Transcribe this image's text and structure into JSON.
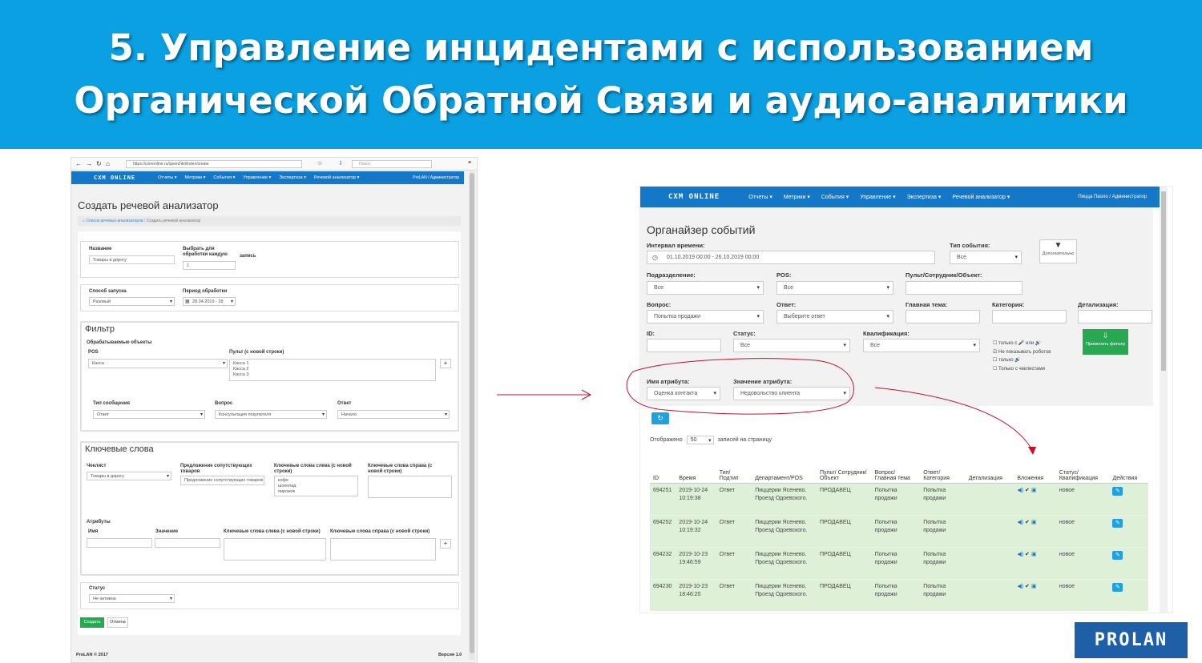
{
  "title": {
    "line1": "5. Управление инцидентами с использованием",
    "line2": "Органической Обратной Связи и аудио-аналитики"
  },
  "browser": {
    "url": "https://cxmonline.ru/speechkit/index/create",
    "search": "Поиск"
  },
  "app": {
    "logo": "CXM ONLINE",
    "nav": [
      "Отчеты ▾",
      "Метрики ▾",
      "События ▾",
      "Управление ▾",
      "Экспертиза ▾",
      "Речевой анализатор ▾"
    ],
    "user_left": "ProLAN / Администратор",
    "user_right": "Пицца Паоло / Администратор"
  },
  "left": {
    "page_title": "Создать речевой анализатор",
    "breadcrumb": [
      "Список речевых анализаторов",
      "Создать речевой анализатор"
    ],
    "name_label": "Название",
    "name_value": "Товары в дорогу",
    "every_label": "Выбрать для обработки каждую",
    "every_value": "1",
    "every_suffix": "запись",
    "launch_label": "Способ запуска",
    "launch_value": "Разовый",
    "period_label": "Период обработки",
    "period_value": "28.04.2019 - 28",
    "filter_title": "Фильтр",
    "objects_label": "Обрабатываемые объекты",
    "pos_label": "POS",
    "pos_value": "Касса",
    "consoles_label": "Пульт (с новой строки)",
    "consoles": [
      "Касса 1",
      "Касса 2",
      "Касса 3"
    ],
    "msgtype_label": "Тип сообщения",
    "msgtype_value": "Ответ",
    "question_label": "Вопрос",
    "question_value": "Консультация покупателя",
    "answer_label": "Ответ",
    "answer_value": "Начало",
    "keywords_title": "Ключевые слова",
    "checklist_label": "Чеклист",
    "checklist_value": "Товары в дорогу",
    "upsell_label": "Предложение сопутствующих товаров",
    "upsell_value": "Предложение сопутствующих товаров",
    "kw_left_label": "Ключевые слова слева (с новой строки)",
    "kw_left": [
      "кофе",
      "шоколад",
      "пирожок"
    ],
    "kw_right_label": "Ключевые слова справа (с новой строки)",
    "attrs_label": "Атрибуты",
    "attr_name": "Имя",
    "attr_value": "Значение",
    "attr_kw_left": "Ключевые слова слева (с новой строки)",
    "attr_kw_right": "Ключевые слова справа (с новой строки)",
    "status_label": "Статус",
    "status_value": "Не активна",
    "create": "Создать",
    "cancel": "Отмена",
    "footer_left": "ProLAN © 2017",
    "footer_right": "Версия 1.0"
  },
  "right": {
    "page_title": "Органайзер событий",
    "interval_label": "Интервал времени:",
    "interval_value": "01.10.2019 00:00 - 26.10.2019 00:00",
    "evtype_label": "Тип события:",
    "evtype_value": "Все",
    "more_label": "Дополнительно",
    "dept_label": "Подразделение:",
    "dept_value": "Все",
    "pos_label": "POS:",
    "pos_value": "Все",
    "staff_label": "Пульт/Сотрудник/Объект:",
    "question_label": "Вопрос:",
    "question_value": "Попытка продажи",
    "answer_label": "Ответ:",
    "answer_value": "Выберите ответ",
    "topic_label": "Главная тема:",
    "category_label": "Категория:",
    "detail_label": "Детализация:",
    "id_label": "ID:",
    "status_label": "Статус:",
    "status_value": "Все",
    "qual_label": "Квалификация:",
    "qual_value": "Все",
    "checks": [
      "только с 🎤 или 🔊",
      "Не показывать роботов",
      "только 🔊",
      "Только с чеклистами"
    ],
    "apply": "Применить фильтр",
    "attr_name_label": "Имя атрибута:",
    "attr_name_value": "Оценка контакта",
    "attr_value_label": "Значение атрибута:",
    "attr_value_value": "Недовольство клиента",
    "shown": "Отображено",
    "per_page": "50",
    "per_page_suffix": "записей на страницу",
    "columns": [
      "ID",
      "Время",
      "Тип/ Подтип",
      "Департамент/POS",
      "Пульт/ Сотрудник/ Объект",
      "Вопрос/ Главная тема",
      "Ответ/ Категория",
      "Детализация",
      "Вложения",
      "Статус/ Квалификация",
      "Действия"
    ],
    "rows": [
      {
        "id": "694251",
        "time": "2019-10-24 10:19:38",
        "type": "Ответ",
        "dept": "Пиццерии Ясенево. Проезд Одоевского.",
        "obj": "ПРОДАВЕЦ",
        "question": "Попытка продажи",
        "answer": "Попытка продажи",
        "detail": "",
        "status": "новое"
      },
      {
        "id": "694252",
        "time": "2019-10-24 10:19:32",
        "type": "Ответ",
        "dept": "Пиццерии Ясенево. Проезд Одоевского.",
        "obj": "ПРОДАВЕЦ",
        "question": "Попытка продажи",
        "answer": "Попытка продажи",
        "detail": "",
        "status": "новое"
      },
      {
        "id": "694232",
        "time": "2019-10-23 19:46:59",
        "type": "Ответ",
        "dept": "Пиццерии Ясенево. Проезд Одоевского.",
        "obj": "ПРОДАВЕЦ",
        "question": "Попытка продажи",
        "answer": "Попытка продажи",
        "detail": "",
        "status": "новое"
      },
      {
        "id": "694230",
        "time": "2019-10-23 18:46:20",
        "type": "Ответ",
        "dept": "Пиццерии Ясенево. Проезд Одоевского.",
        "obj": "ПРОДАВЕЦ",
        "question": "Попытка продажи",
        "answer": "Попытка продажи",
        "detail": "",
        "status": "новое"
      }
    ]
  },
  "brand": {
    "logo": "PROLAN"
  },
  "colors": {
    "banner": "#0aa0e2",
    "navbar": "#1577c8",
    "success": "#27a851",
    "row": "#dff0d8",
    "annotation": "#c8102e"
  }
}
